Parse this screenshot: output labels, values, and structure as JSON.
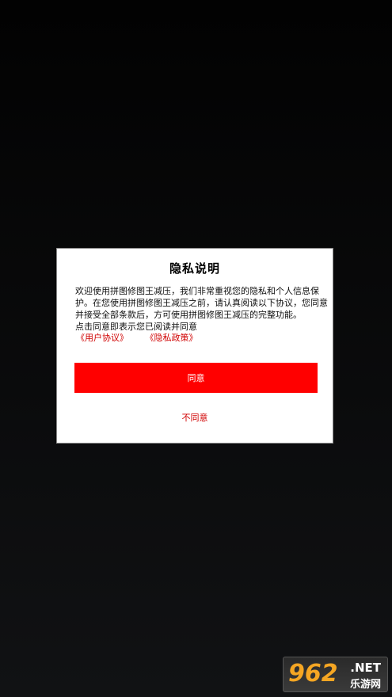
{
  "dialog": {
    "title": "隐私说明",
    "paragraph": "欢迎使用拼图修图王减压，我们非常重视您的隐私和个人信息保护。在您使用拼图修图王减压之前，请认真阅读以下协议，您同意并接受全部条款后，方可使用拼图修图王减压的完整功能。",
    "notice": "点击同意即表示您已阅读并同意",
    "user_agreement_link": "《用户协议》",
    "privacy_policy_link": "《隐私政策》",
    "agree_label": "同意",
    "disagree_label": "不同意"
  },
  "watermark": {
    "logo": "962",
    "net": ".NET",
    "site": "乐游网"
  },
  "colors": {
    "accent_red": "#ff0000",
    "link_red": "#d00000",
    "dialog_bg": "#ffffff",
    "screen_bg": "#0a0a0a"
  }
}
